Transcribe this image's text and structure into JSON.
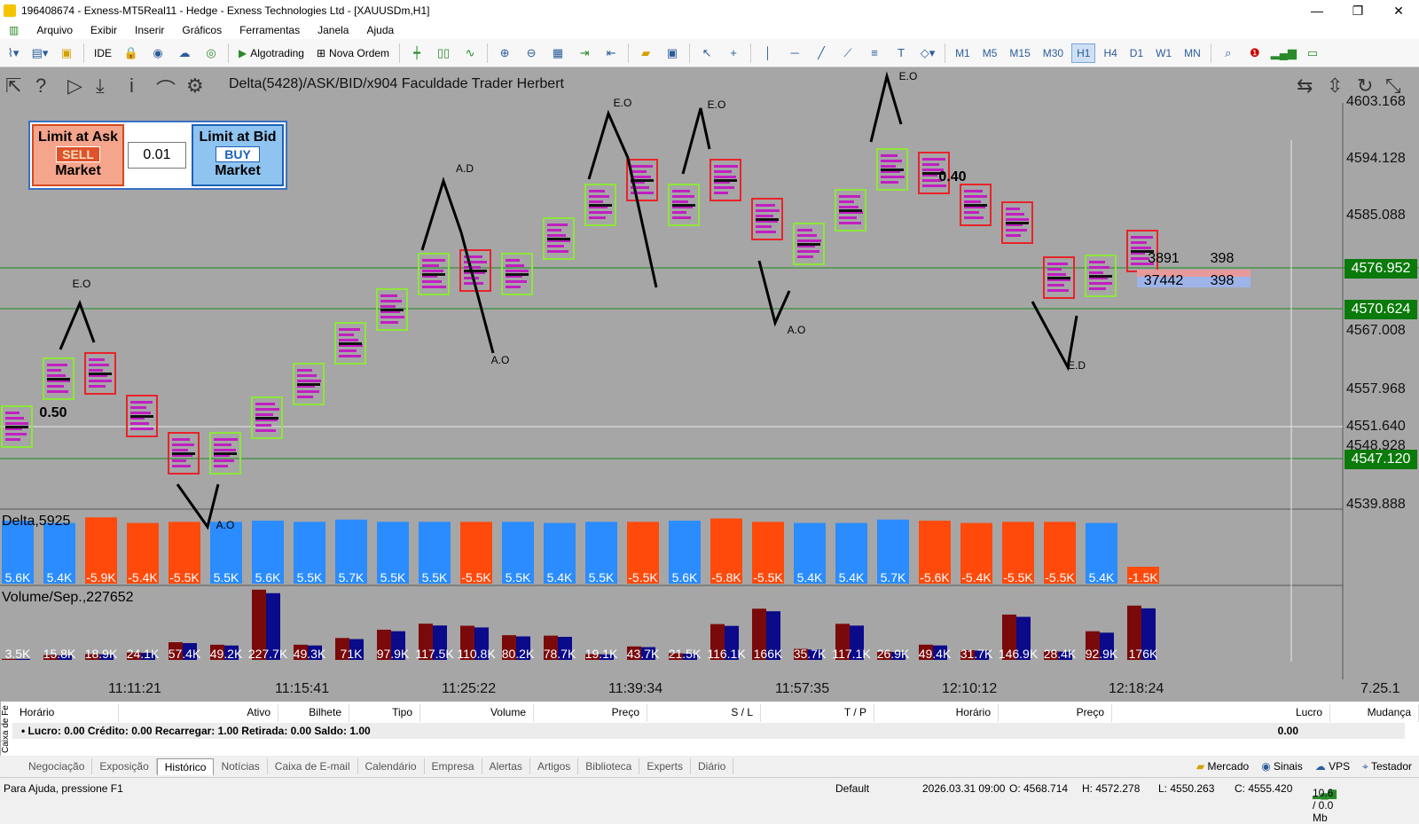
{
  "window": {
    "title": "196408674 - Exness-MT5Real11 - Hedge - Exness Technologies Ltd - [XAUUSDm,H1]"
  },
  "menu": [
    "Arquivo",
    "Exibir",
    "Inserir",
    "Gráficos",
    "Ferramentas",
    "Janela",
    "Ajuda"
  ],
  "toolbar": {
    "ide": "IDE",
    "algotrading": "Algotrading",
    "nova_ordem": "Nova Ordem",
    "timeframes": [
      "M1",
      "M5",
      "M15",
      "M30",
      "H1",
      "H4",
      "D1",
      "W1",
      "MN"
    ],
    "active_tf": "H1"
  },
  "chart": {
    "indicator_label": "Delta(5428)/ASK/BID/x904   Faculdade Trader Herbert",
    "panel": {
      "ask_title": "Limit at Ask",
      "sell": "SELL",
      "market": "Market",
      "lot": "0.01",
      "bid_title": "Limit at Bid",
      "buy": "BUY"
    },
    "price_labels": [
      "4603.168",
      "4594.128",
      "4585.088",
      "4567.008",
      "4557.968",
      "4551.640",
      "4548.928",
      "4539.888"
    ],
    "price_tags": [
      "4576.952",
      "4570.624",
      "4547.120"
    ],
    "annotations": [
      "E.O",
      "A.D",
      "E.O",
      "E.O",
      "E.O",
      "A.O",
      "A.O",
      "A.O",
      "E.D",
      "0.40",
      "0.50"
    ],
    "live_box": {
      "a1": "3891",
      "a2": "398",
      "b1": "37442",
      "b2": "398"
    },
    "delta_title": "Delta,5925",
    "delta_values": [
      "5.6K",
      "5.4K",
      "-5.9K",
      "-5.4K",
      "-5.5K",
      "5.5K",
      "5.6K",
      "5.5K",
      "5.7K",
      "5.5K",
      "5.5K",
      "-5.5K",
      "5.5K",
      "5.4K",
      "5.5K",
      "-5.5K",
      "5.6K",
      "-5.8K",
      "-5.5K",
      "5.4K",
      "5.4K",
      "5.7K",
      "-5.6K",
      "-5.4K",
      "-5.5K",
      "-5.5K",
      "5.4K",
      "-1.5K"
    ],
    "volume_title": "Volume/Sep.,227652",
    "volume_values": [
      "3.5K",
      "15.8K",
      "18.9K",
      "24.1K",
      "57.4K",
      "49.2K",
      "227.7K",
      "49.3K",
      "71K",
      "97.9K",
      "117.5K",
      "110.8K",
      "80.2K",
      "78.7K",
      "19.1K",
      "43.7K",
      "21.5K",
      "116.1K",
      "166K",
      "35.7K",
      "117.1K",
      "26.9K",
      "49.4K",
      "31.7K",
      "146.9K",
      "28.4K",
      "92.9K",
      "176K"
    ],
    "time_labels": [
      "11:11:21",
      "11:15:41",
      "11:25:22",
      "11:39:34",
      "11:57:35",
      "12:10:12",
      "12:18:24"
    ],
    "version": "7.25.1"
  },
  "terminal": {
    "side_label": "Caixa de Fe",
    "columns": [
      "Horário",
      "Ativo",
      "Bilhete",
      "Tipo",
      "Volume",
      "Preço",
      "S / L",
      "T / P",
      "Horário",
      "Preço",
      "Lucro",
      "Mudança"
    ],
    "summary": "•  Lucro: 0.00  Crédito: 0.00  Recarregar: 1.00  Retirada: 0.00  Saldo: 1.00",
    "profit": "0.00"
  },
  "tabs": [
    "Negociação",
    "Exposição",
    "Histórico",
    "Notícias",
    "Caixa de E-mail",
    "Calendário",
    "Empresa",
    "Alertas",
    "Artigos",
    "Biblioteca",
    "Experts",
    "Diário"
  ],
  "active_tab": "Histórico",
  "tabs_right": [
    "Mercado",
    "Sinais",
    "VPS",
    "Testador"
  ],
  "status": {
    "help": "Para Ajuda, pressione F1",
    "profile": "Default",
    "datetime": "2026.03.31 09:00",
    "open": "O: 4568.714",
    "high": "H: 4572.278",
    "low": "L: 4550.263",
    "close": "C: 4555.420",
    "traffic": "10.6 / 0.0 Mb"
  }
}
